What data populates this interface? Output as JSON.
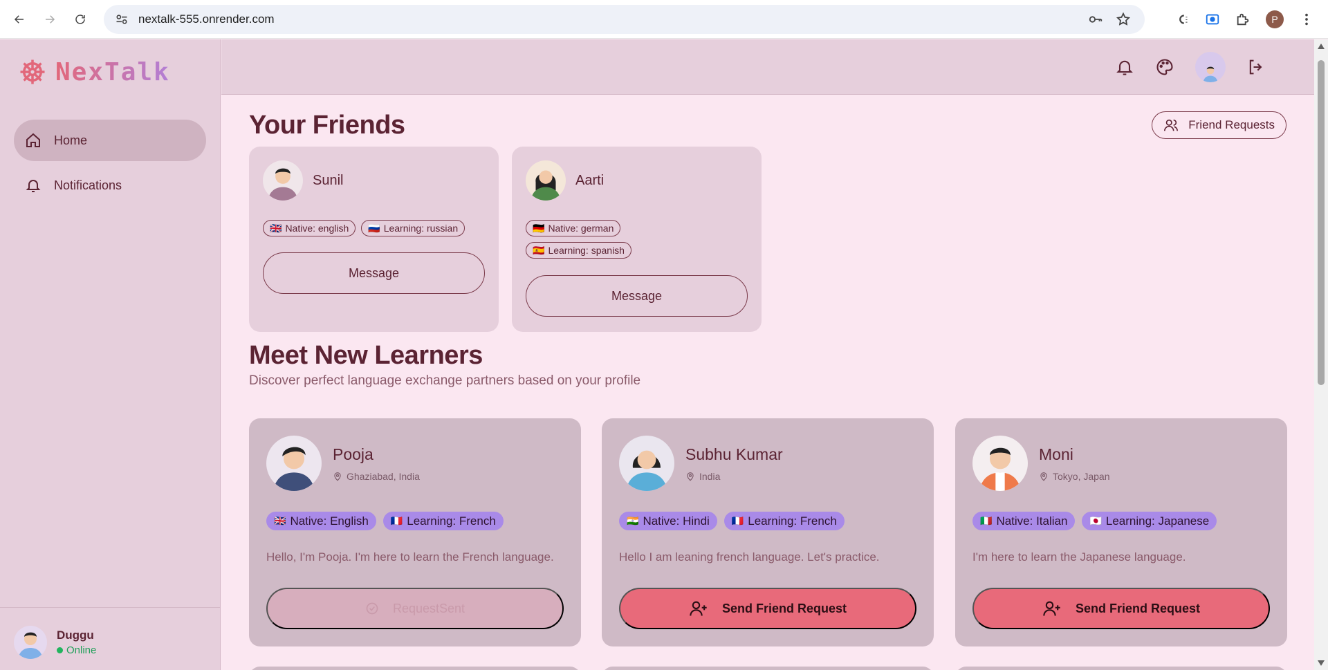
{
  "browser": {
    "url": "nextalk-555.onrender.com",
    "profile_initial": "P"
  },
  "app": {
    "name": "NexTalk",
    "brand_colors": {
      "primary": "#e86a7a",
      "secondary": "#b27fd6"
    }
  },
  "sidebar": {
    "items": [
      {
        "label": "Home",
        "icon": "home-icon",
        "active": true
      },
      {
        "label": "Notifications",
        "icon": "bell-icon",
        "active": false
      }
    ],
    "user": {
      "name": "Duggu",
      "status": "Online"
    }
  },
  "topbar": {
    "icons": [
      "bell-icon",
      "palette-icon",
      "avatar",
      "logout-icon"
    ]
  },
  "friends": {
    "title": "Your Friends",
    "requests_label": "Friend Requests",
    "list": [
      {
        "name": "Sunil",
        "native": "Native: english",
        "native_flag": "🇬🇧",
        "learning": "Learning: russian",
        "learning_flag": "🇷🇺",
        "button": "Message"
      },
      {
        "name": "Aarti",
        "native": "Native: german",
        "native_flag": "🇩🇪",
        "learning": "Learning: spanish",
        "learning_flag": "🇪🇸",
        "button": "Message"
      }
    ]
  },
  "learners": {
    "title": "Meet New Learners",
    "subtitle": "Discover perfect language exchange partners based on your profile",
    "list": [
      {
        "name": "Pooja",
        "location": "Ghaziabad, India",
        "native": "Native: English",
        "native_flag": "🇬🇧",
        "learning": "Learning: French",
        "learning_flag": "🇫🇷",
        "bio": "Hello, I'm Pooja. I'm here to learn the French language.",
        "button": "RequestSent",
        "sent": true
      },
      {
        "name": "Subhu Kumar",
        "location": "India",
        "native": "Native: Hindi",
        "native_flag": "🇮🇳",
        "learning": "Learning: French",
        "learning_flag": "🇫🇷",
        "bio": "Hello I am leaning french language. Let's practice.",
        "button": "Send Friend Request",
        "sent": false
      },
      {
        "name": "Moni",
        "location": "Tokyo, Japan",
        "native": "Native: Italian",
        "native_flag": "🇮🇹",
        "learning": "Learning: Japanese",
        "learning_flag": "🇯🇵",
        "bio": "I'm here to learn the Japanese language.",
        "button": "Send Friend Request",
        "sent": false
      }
    ]
  }
}
